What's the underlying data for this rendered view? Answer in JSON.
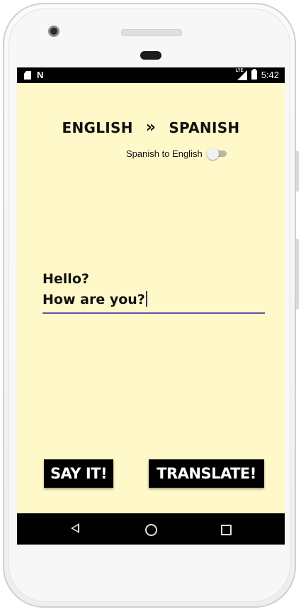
{
  "status_bar": {
    "time": "5:42",
    "icons": [
      "sd-card-icon",
      "n-logo-icon",
      "lte-signal-icon",
      "battery-charging-icon"
    ],
    "network_label": "LTE"
  },
  "header": {
    "source_language": "ENGLISH",
    "arrow_glyph": "»",
    "target_language": "SPANISH"
  },
  "toggle": {
    "label": "Spanish to English",
    "checked": false
  },
  "input": {
    "line1": "Hello?",
    "line2": "How are you?"
  },
  "buttons": {
    "say_label": "SAY IT!",
    "translate_label": "TRANSLATE!"
  },
  "navbar": {
    "icons": [
      "back-icon",
      "home-icon",
      "recents-icon"
    ]
  },
  "colors": {
    "app_background": "#fff8c8",
    "button_background": "#000000",
    "input_underline": "#6a4fa0"
  }
}
